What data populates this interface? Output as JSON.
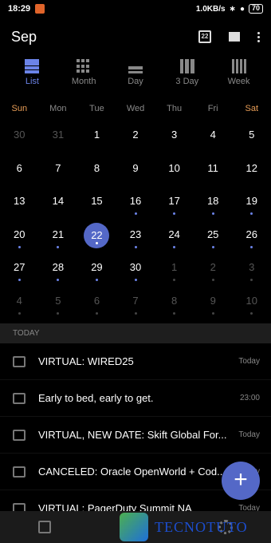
{
  "status": {
    "time": "18:29",
    "speed": "1.0KB/s",
    "battery": "70"
  },
  "header": {
    "month": "Sep",
    "calendar_day": "22"
  },
  "views": [
    {
      "label": "List",
      "icon": "list-view-icon",
      "active": true
    },
    {
      "label": "Month",
      "icon": "month-view-icon",
      "active": false
    },
    {
      "label": "Day",
      "icon": "day-view-icon",
      "active": false
    },
    {
      "label": "3 Day",
      "icon": "three-day-view-icon",
      "active": false
    },
    {
      "label": "Week",
      "icon": "week-view-icon",
      "active": false
    }
  ],
  "weekdays": [
    "Sun",
    "Mon",
    "Tue",
    "Wed",
    "Thu",
    "Fri",
    "Sat"
  ],
  "weeks": [
    [
      {
        "n": "30",
        "m": true
      },
      {
        "n": "31",
        "m": true
      },
      {
        "n": "1"
      },
      {
        "n": "2"
      },
      {
        "n": "3"
      },
      {
        "n": "4"
      },
      {
        "n": "5"
      }
    ],
    [
      {
        "n": "6"
      },
      {
        "n": "7"
      },
      {
        "n": "8"
      },
      {
        "n": "9"
      },
      {
        "n": "10"
      },
      {
        "n": "11"
      },
      {
        "n": "12"
      }
    ],
    [
      {
        "n": "13"
      },
      {
        "n": "14"
      },
      {
        "n": "15"
      },
      {
        "n": "16",
        "d": true
      },
      {
        "n": "17",
        "d": true
      },
      {
        "n": "18",
        "d": true
      },
      {
        "n": "19",
        "d": true
      }
    ],
    [
      {
        "n": "20",
        "d": true
      },
      {
        "n": "21",
        "d": true
      },
      {
        "n": "22",
        "d": true,
        "t": true
      },
      {
        "n": "23",
        "d": true
      },
      {
        "n": "24",
        "d": true
      },
      {
        "n": "25",
        "d": true
      },
      {
        "n": "26",
        "d": true
      }
    ],
    [
      {
        "n": "27",
        "d": true
      },
      {
        "n": "28",
        "d": true
      },
      {
        "n": "29",
        "d": true
      },
      {
        "n": "30",
        "d": true
      },
      {
        "n": "1",
        "m": true,
        "d": true
      },
      {
        "n": "2",
        "m": true,
        "d": true
      },
      {
        "n": "3",
        "m": true,
        "d": true
      }
    ],
    [
      {
        "n": "4",
        "m": true,
        "d": true
      },
      {
        "n": "5",
        "m": true,
        "d": true
      },
      {
        "n": "6",
        "m": true,
        "d": true
      },
      {
        "n": "7",
        "m": true,
        "d": true
      },
      {
        "n": "8",
        "m": true,
        "d": true
      },
      {
        "n": "9",
        "m": true,
        "d": true
      },
      {
        "n": "10",
        "m": true,
        "d": true
      }
    ]
  ],
  "section_label": "TODAY",
  "events": [
    {
      "title": "VIRTUAL: WIRED25",
      "when": "Today"
    },
    {
      "title": "Early to bed, early to get.",
      "when": "23:00"
    },
    {
      "title": "VIRTUAL, NEW DATE: Skift Global For...",
      "when": "Today"
    },
    {
      "title": "CANCELED: Oracle OpenWorld + Cod...",
      "when": "Today"
    },
    {
      "title": "VIRTUAL: PagerDuty Summit NA",
      "when": "Today"
    }
  ],
  "fab_label": "+",
  "watermark": "TECNOTUTO",
  "colors": {
    "accent": "#5468c7",
    "weekend": "#e69c56",
    "background": "#000000"
  }
}
